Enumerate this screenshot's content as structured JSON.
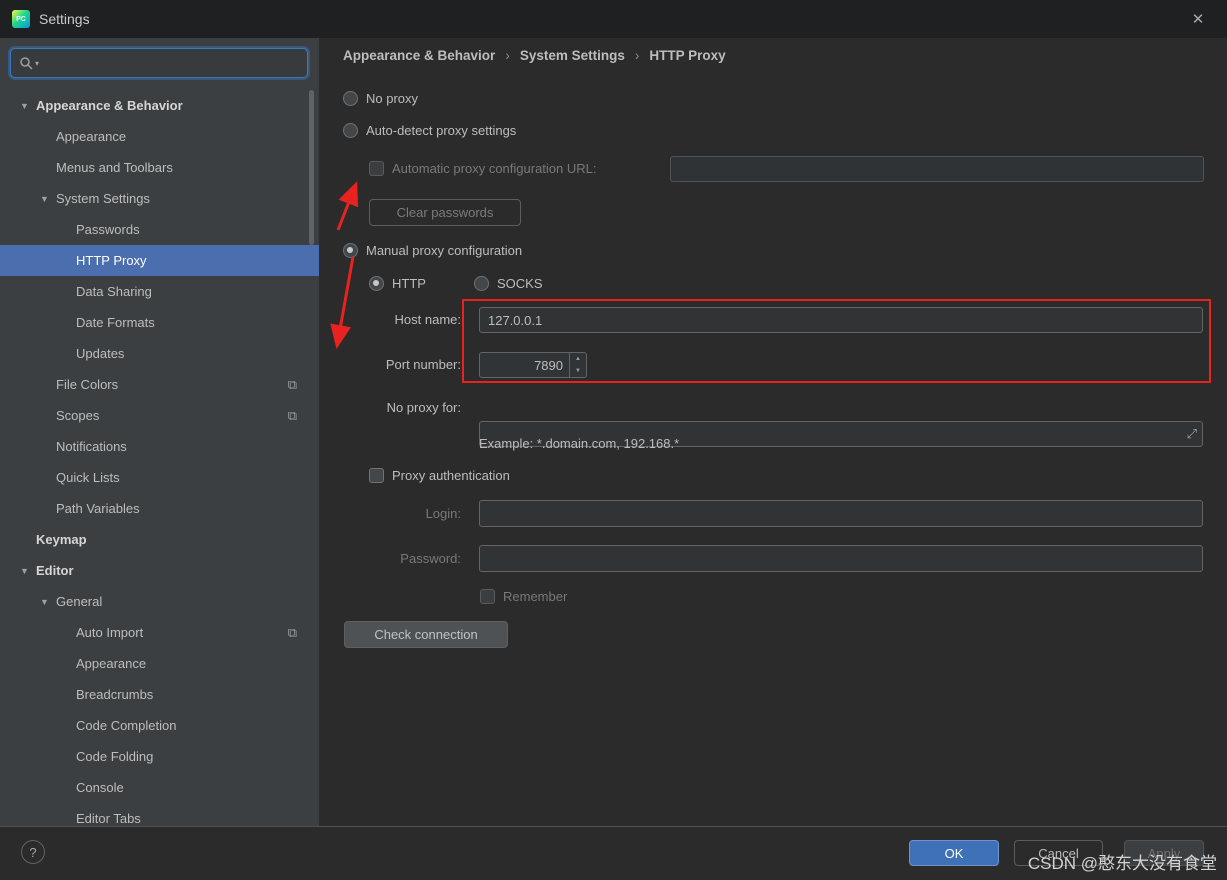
{
  "window": {
    "title": "Settings"
  },
  "icons": {
    "close": "✕",
    "tree_expanded": "▼",
    "shared": "⧉",
    "search_chevron": "▾",
    "expand": "⤢",
    "spin_up": "▲",
    "spin_down": "▼",
    "help": "?"
  },
  "colors": {
    "selection_blue": "#4b6eaf",
    "ok_button_blue": "#3e71b8",
    "annotation_red": "#e8231f",
    "sidebar_bg": "#3c3f41",
    "main_bg": "#2b2b2b"
  },
  "sidebar": {
    "items": [
      {
        "label": "Appearance & Behavior"
      },
      {
        "label": "Appearance"
      },
      {
        "label": "Menus and Toolbars"
      },
      {
        "label": "System Settings"
      },
      {
        "label": "Passwords"
      },
      {
        "label": "HTTP Proxy"
      },
      {
        "label": "Data Sharing"
      },
      {
        "label": "Date Formats"
      },
      {
        "label": "Updates"
      },
      {
        "label": "File Colors"
      },
      {
        "label": "Scopes"
      },
      {
        "label": "Notifications"
      },
      {
        "label": "Quick Lists"
      },
      {
        "label": "Path Variables"
      },
      {
        "label": "Keymap"
      },
      {
        "label": "Editor"
      },
      {
        "label": "General"
      },
      {
        "label": "Auto Import"
      },
      {
        "label": "Appearance"
      },
      {
        "label": "Breadcrumbs"
      },
      {
        "label": "Code Completion"
      },
      {
        "label": "Code Folding"
      },
      {
        "label": "Console"
      },
      {
        "label": "Editor Tabs"
      }
    ]
  },
  "breadcrumb": {
    "separator": "›",
    "parts": [
      "Appearance & Behavior",
      "System Settings",
      "HTTP Proxy"
    ]
  },
  "form": {
    "no_proxy_label": "No proxy",
    "auto_detect_label": "Auto-detect proxy settings",
    "auto_url_label": "Automatic proxy configuration URL:",
    "clear_passwords_label": "Clear passwords",
    "manual_label": "Manual proxy configuration",
    "http_label": "HTTP",
    "socks_label": "SOCKS",
    "host_label": "Host name:",
    "host_value": "127.0.0.1",
    "port_label": "Port number:",
    "port_value": "7890",
    "no_proxy_for_label": "No proxy for:",
    "example_text": "Example: *.domain.com, 192.168.*",
    "proxy_auth_label": "Proxy authentication",
    "login_label": "Login:",
    "password_label": "Password:",
    "remember_label": "Remember",
    "check_connection_label": "Check connection"
  },
  "footer": {
    "ok": "OK",
    "cancel": "Cancel",
    "apply": "Apply"
  },
  "watermark": "CSDN @憨东大没有食堂"
}
